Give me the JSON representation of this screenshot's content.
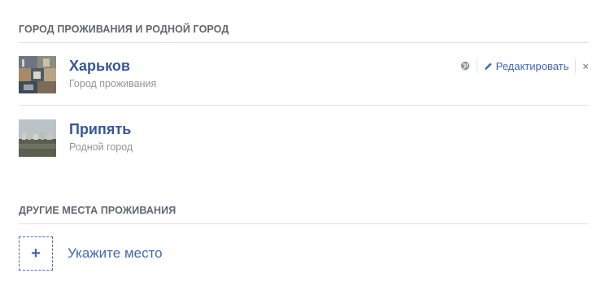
{
  "current_section": {
    "header": "ГОРОД ПРОЖИВАНИЯ И РОДНОЙ ГОРОД",
    "places": [
      {
        "name": "Харьков",
        "subtitle": "Город проживания",
        "image": "kharkiv-city-collage-thumbnail",
        "actions": {
          "privacy_icon": "globe-icon",
          "edit_label": "Редактировать",
          "edit_icon": "pencil-icon",
          "close_label": "×"
        }
      },
      {
        "name": "Припять",
        "subtitle": "Родной город",
        "image": "pripyat-landscape-thumbnail"
      }
    ]
  },
  "other_section": {
    "header": "ДРУГИЕ МЕСТА ПРОЖИВАНИЯ",
    "add_symbol": "+",
    "add_label": "Укажите место"
  },
  "colors": {
    "link": "#365899",
    "accent": "#4267b2",
    "muted": "#90949c",
    "header": "#606770",
    "divider": "#dddfe2"
  }
}
